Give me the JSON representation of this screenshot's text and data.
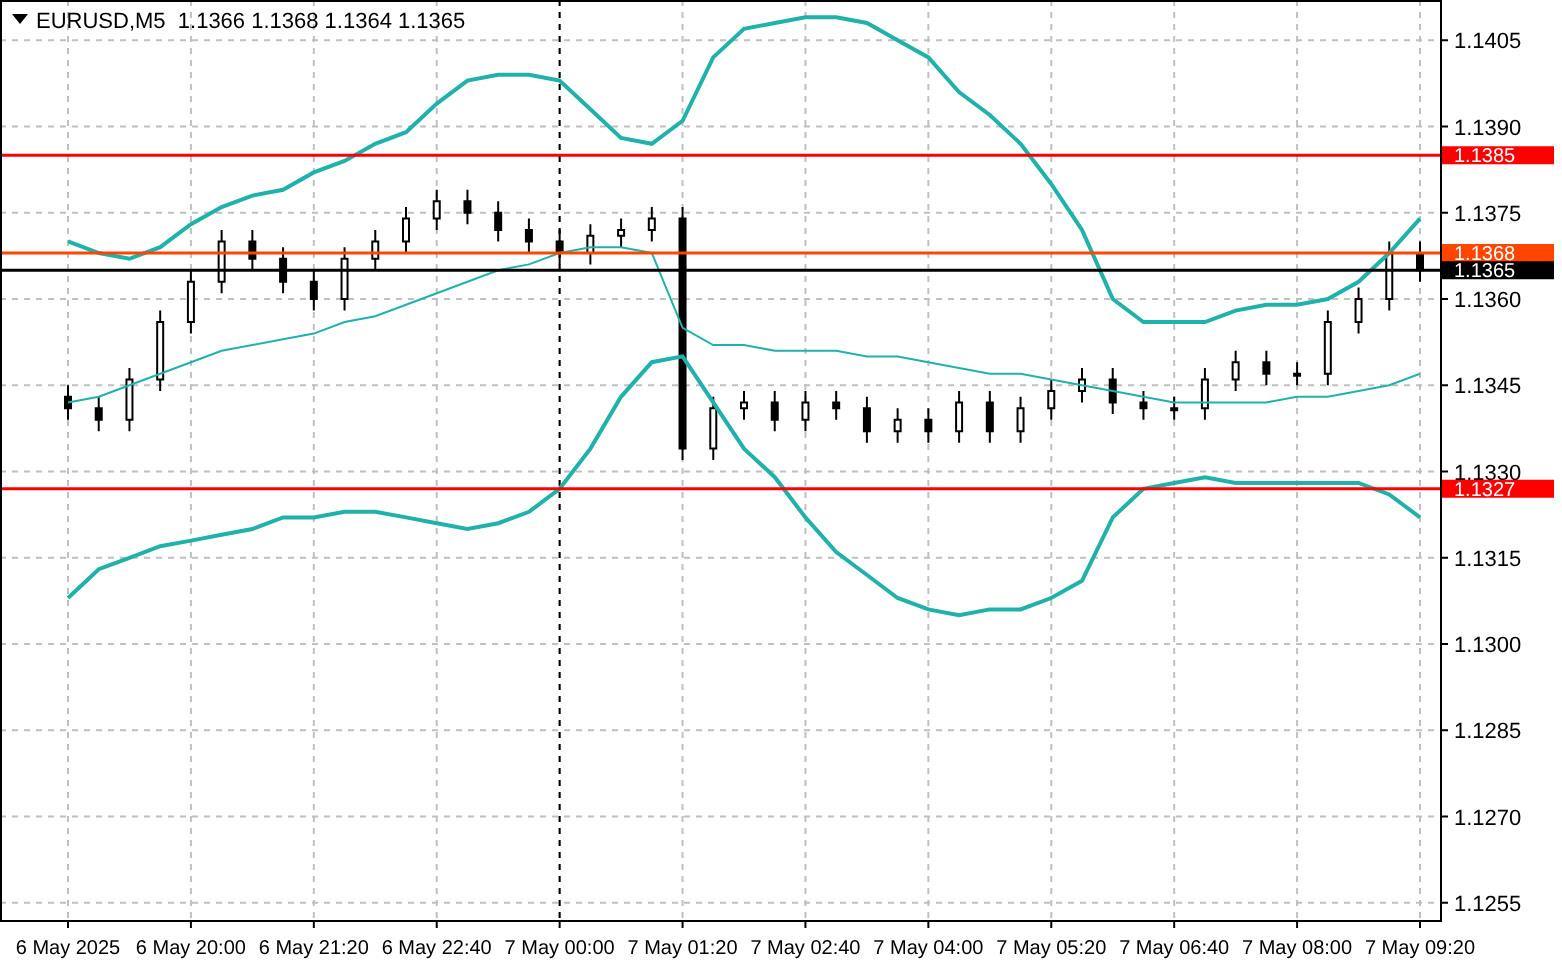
{
  "chart": {
    "title": "EURUSD,M5  1.1366 1.1368 1.1364 1.1365",
    "chart_data": {
      "type": "candlestick",
      "ylim": [
        1.1252,
        1.1412
      ],
      "grid": true,
      "ref_lines": [
        {
          "axis": "y",
          "value": 1.1385,
          "label": "1.1385",
          "color": "#ff0000"
        },
        {
          "axis": "y",
          "value": 1.1368,
          "label": "1.1368",
          "color": "#ff4500"
        },
        {
          "axis": "y",
          "value": 1.1365,
          "label": "1.1365",
          "color": "#000000"
        },
        {
          "axis": "y",
          "value": 1.1327,
          "label": "1.1327",
          "color": "#ff0000"
        },
        {
          "axis": "x",
          "value": "7 May 00:00",
          "color": "#000000"
        }
      ],
      "categories": [
        "6 May 2025",
        null,
        null,
        null,
        "6 May 20:00",
        null,
        null,
        null,
        "6 May 21:20",
        null,
        null,
        null,
        "6 May 22:40",
        null,
        null,
        null,
        "7 May 00:00",
        null,
        null,
        null,
        "7 May 01:20",
        null,
        null,
        null,
        "7 May 02:40",
        null,
        null,
        null,
        "7 May 04:00",
        null,
        null,
        null,
        "7 May 05:20",
        null,
        null,
        null,
        "7 May 06:40",
        null,
        null,
        null,
        "7 May 08:00",
        null,
        null,
        null,
        "7 May 09:20"
      ],
      "yticks": [
        {
          "value": 1.1405,
          "label": "1.1405"
        },
        {
          "value": 1.139,
          "label": "1.1390"
        },
        {
          "value": 1.1375,
          "label": "1.1375"
        },
        {
          "value": 1.136,
          "label": "1.1360"
        },
        {
          "value": 1.1345,
          "label": "1.1345"
        },
        {
          "value": 1.133,
          "label": "1.1330"
        },
        {
          "value": 1.1315,
          "label": "1.1315"
        },
        {
          "value": 1.13,
          "label": "1.1300"
        },
        {
          "value": 1.1285,
          "label": "1.1285"
        },
        {
          "value": 1.127,
          "label": "1.1270"
        },
        {
          "value": 1.1255,
          "label": "1.1255"
        }
      ],
      "ohlc": [
        [
          1.1343,
          1.1345,
          1.1339,
          1.1341
        ],
        [
          1.1341,
          1.1343,
          1.1337,
          1.1339
        ],
        [
          1.1339,
          1.1348,
          1.1337,
          1.1346
        ],
        [
          1.1346,
          1.1358,
          1.1344,
          1.1356
        ],
        [
          1.1356,
          1.1365,
          1.1354,
          1.1363
        ],
        [
          1.1363,
          1.1372,
          1.1361,
          1.137
        ],
        [
          1.137,
          1.1372,
          1.1365,
          1.1367
        ],
        [
          1.1367,
          1.1369,
          1.1361,
          1.1363
        ],
        [
          1.1363,
          1.1365,
          1.1358,
          1.136
        ],
        [
          1.136,
          1.1369,
          1.1358,
          1.1367
        ],
        [
          1.1367,
          1.1372,
          1.1365,
          1.137
        ],
        [
          1.137,
          1.1376,
          1.1368,
          1.1374
        ],
        [
          1.1374,
          1.1379,
          1.1372,
          1.1377
        ],
        [
          1.1377,
          1.1379,
          1.1373,
          1.1375
        ],
        [
          1.1375,
          1.1377,
          1.137,
          1.1372
        ],
        [
          1.1372,
          1.1374,
          1.1368,
          1.137
        ],
        [
          1.137,
          1.1372,
          1.1366,
          1.1368
        ],
        [
          1.1368,
          1.1373,
          1.1366,
          1.1371
        ],
        [
          1.1371,
          1.1374,
          1.1369,
          1.1372
        ],
        [
          1.1372,
          1.1376,
          1.137,
          1.1374
        ],
        [
          1.1374,
          1.1376,
          1.1332,
          1.1334
        ],
        [
          1.1334,
          1.1343,
          1.1332,
          1.1341
        ],
        [
          1.1341,
          1.1344,
          1.1339,
          1.1342
        ],
        [
          1.1342,
          1.1344,
          1.1337,
          1.1339
        ],
        [
          1.1339,
          1.1344,
          1.1337,
          1.1342
        ],
        [
          1.1342,
          1.1344,
          1.1339,
          1.1341
        ],
        [
          1.1341,
          1.1343,
          1.1335,
          1.1337
        ],
        [
          1.1337,
          1.1341,
          1.1335,
          1.1339
        ],
        [
          1.1339,
          1.1341,
          1.1335,
          1.1337
        ],
        [
          1.1337,
          1.1344,
          1.1335,
          1.1342
        ],
        [
          1.1342,
          1.1344,
          1.1335,
          1.1337
        ],
        [
          1.1337,
          1.1343,
          1.1335,
          1.1341
        ],
        [
          1.1341,
          1.1346,
          1.1339,
          1.1344
        ],
        [
          1.1344,
          1.1348,
          1.1342,
          1.1346
        ],
        [
          1.1346,
          1.1348,
          1.134,
          1.1342
        ],
        [
          1.1342,
          1.1344,
          1.1339,
          1.1341
        ],
        [
          1.1341,
          1.1343,
          1.1339,
          1.1341
        ],
        [
          1.1341,
          1.1348,
          1.1339,
          1.1346
        ],
        [
          1.1346,
          1.1351,
          1.1344,
          1.1349
        ],
        [
          1.1349,
          1.1351,
          1.1345,
          1.1347
        ],
        [
          1.1347,
          1.1349,
          1.1345,
          1.1347
        ],
        [
          1.1347,
          1.1358,
          1.1345,
          1.1356
        ],
        [
          1.1356,
          1.1362,
          1.1354,
          1.136
        ],
        [
          1.136,
          1.137,
          1.1358,
          1.1368
        ],
        [
          1.1368,
          1.137,
          1.1363,
          1.1365
        ]
      ],
      "series": [
        {
          "type": "line",
          "color": "#20b2aa",
          "values": [
            1.137,
            1.1368,
            1.1367,
            1.1369,
            1.1373,
            1.1376,
            1.1378,
            1.1379,
            1.1382,
            1.1384,
            1.1387,
            1.1389,
            1.1394,
            1.1398,
            1.1399,
            1.1399,
            1.1398,
            1.1393,
            1.1388,
            1.1387,
            1.1391,
            1.1402,
            1.1407,
            1.1408,
            1.1409,
            1.1409,
            1.1408,
            1.1405,
            1.1402,
            1.1396,
            1.1392,
            1.1387,
            1.138,
            1.1372,
            1.136,
            1.1356,
            1.1356,
            1.1356,
            1.1358,
            1.1359,
            1.1359,
            1.136,
            1.1363,
            1.1368,
            1.1374
          ]
        },
        {
          "type": "line",
          "color": "#20b2aa",
          "values": [
            1.1342,
            1.1343,
            1.1345,
            1.1347,
            1.1349,
            1.1351,
            1.1352,
            1.1353,
            1.1354,
            1.1356,
            1.1357,
            1.1359,
            1.1361,
            1.1363,
            1.1365,
            1.1366,
            1.1368,
            1.1369,
            1.1369,
            1.1368,
            1.1355,
            1.1352,
            1.1352,
            1.1351,
            1.1351,
            1.1351,
            1.135,
            1.135,
            1.1349,
            1.1348,
            1.1347,
            1.1347,
            1.1346,
            1.1345,
            1.1344,
            1.1343,
            1.1342,
            1.1342,
            1.1342,
            1.1342,
            1.1343,
            1.1343,
            1.1344,
            1.1345,
            1.1347
          ]
        },
        {
          "type": "line",
          "color": "#20b2aa",
          "values": [
            1.1308,
            1.1313,
            1.1315,
            1.1317,
            1.1318,
            1.1319,
            1.132,
            1.1322,
            1.1322,
            1.1323,
            1.1323,
            1.1322,
            1.1321,
            1.132,
            1.1321,
            1.1323,
            1.1327,
            1.1334,
            1.1343,
            1.1349,
            1.135,
            1.1342,
            1.1334,
            1.1329,
            1.1322,
            1.1316,
            1.1312,
            1.1308,
            1.1306,
            1.1305,
            1.1306,
            1.1306,
            1.1308,
            1.1311,
            1.1322,
            1.1327,
            1.1328,
            1.1329,
            1.1328,
            1.1328,
            1.1328,
            1.1328,
            1.1328,
            1.1326,
            1.1322
          ]
        }
      ]
    }
  }
}
